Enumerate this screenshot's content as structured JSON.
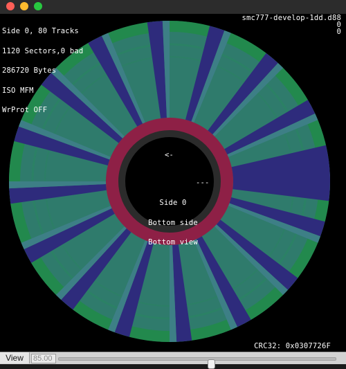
{
  "window": {
    "controls": [
      "close",
      "minimize",
      "zoom"
    ]
  },
  "disk_info": {
    "lines": [
      "Side 0, 80 Tracks",
      "1120 Sectors,0 bad",
      "286720 Bytes",
      "ISO MFM",
      "WrProt OFF"
    ],
    "filename": "smc777-develop-1dd.d88",
    "counter_1": "0",
    "counter_2": "0",
    "crc": "CRC32: 0x0307726F"
  },
  "hub": {
    "arrow": "<-",
    "marker": "---",
    "lines": [
      "Side 0",
      "Bottom side",
      "Bottom view"
    ]
  },
  "view": {
    "label": "View",
    "zoom": "85.00",
    "zoom_level": 0.55
  },
  "colors": {
    "track_fill": "#2f7b6c",
    "track_edge": "#1f8e43",
    "sector_gap": "#2e2b7c",
    "sector_gap_light": "#3d7f86",
    "hub_ring": "#8e2046",
    "hub_inner": "#2b2b2b",
    "hub_center": "#000000"
  }
}
